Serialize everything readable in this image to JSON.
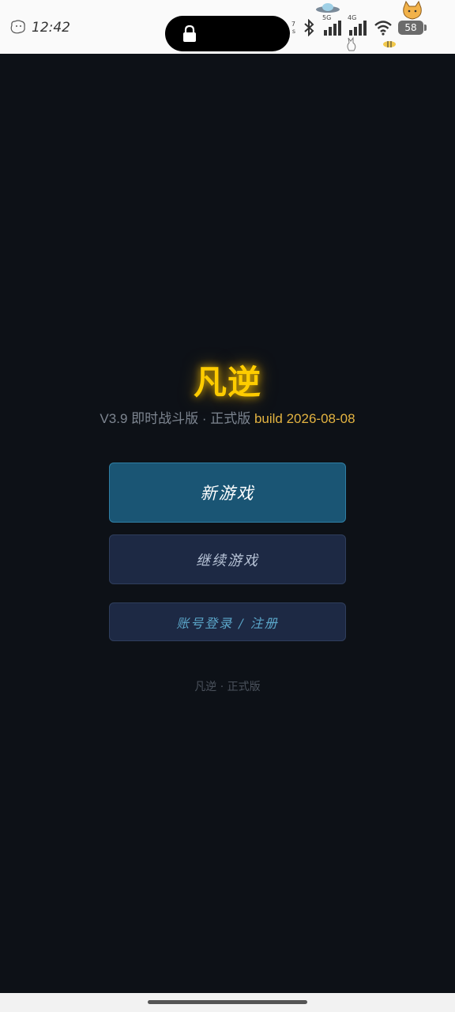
{
  "status_bar": {
    "time": "12:42",
    "net_speed_top": "7",
    "net_speed_bottom": "s",
    "sim1_label": "5G",
    "sim2_label": "4G",
    "battery_level": "58",
    "icons": [
      "lock-icon",
      "bluetooth-icon",
      "signal-5g-icon",
      "signal-4g-icon",
      "wifi-icon",
      "battery-icon"
    ]
  },
  "app": {
    "title": "凡逆",
    "version_prefix": "V3.9 即时战斗版 · 正式版 ",
    "version_build": "build 2026-08-08",
    "colors": {
      "title": "#ffcc00",
      "build": "#e3b341",
      "background": "#0d1117",
      "primary_button": "#1a5574",
      "secondary_button": "#1d2944"
    }
  },
  "menu": {
    "new_game": "新游戏",
    "continue_game": "继续游戏",
    "account": "账号登录 / 注册"
  },
  "footer": {
    "text": "凡逆 · 正式版"
  }
}
